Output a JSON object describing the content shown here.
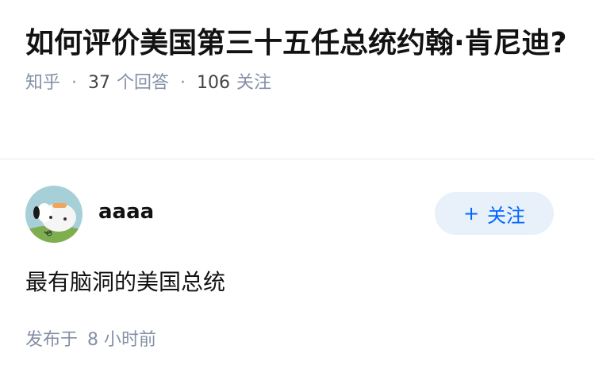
{
  "question": {
    "title": "如何评价美国第三十五任总统约翰·肯尼迪?",
    "source": "知乎",
    "answer_count": "37",
    "answer_label": "个回答",
    "follower_count": "106",
    "follower_label": "关注"
  },
  "answer": {
    "author_name": "aaaa",
    "follow_button": {
      "icon": "plus-icon",
      "label": "关注"
    },
    "content": "最有脑洞的美国总统",
    "time_prefix": "发布于",
    "time_value": "8",
    "time_suffix": "小时前"
  },
  "colors": {
    "accent": "#0066ff",
    "follow_bg": "#e8f0f9",
    "meta_gray": "#8590a6",
    "text": "#121212"
  }
}
